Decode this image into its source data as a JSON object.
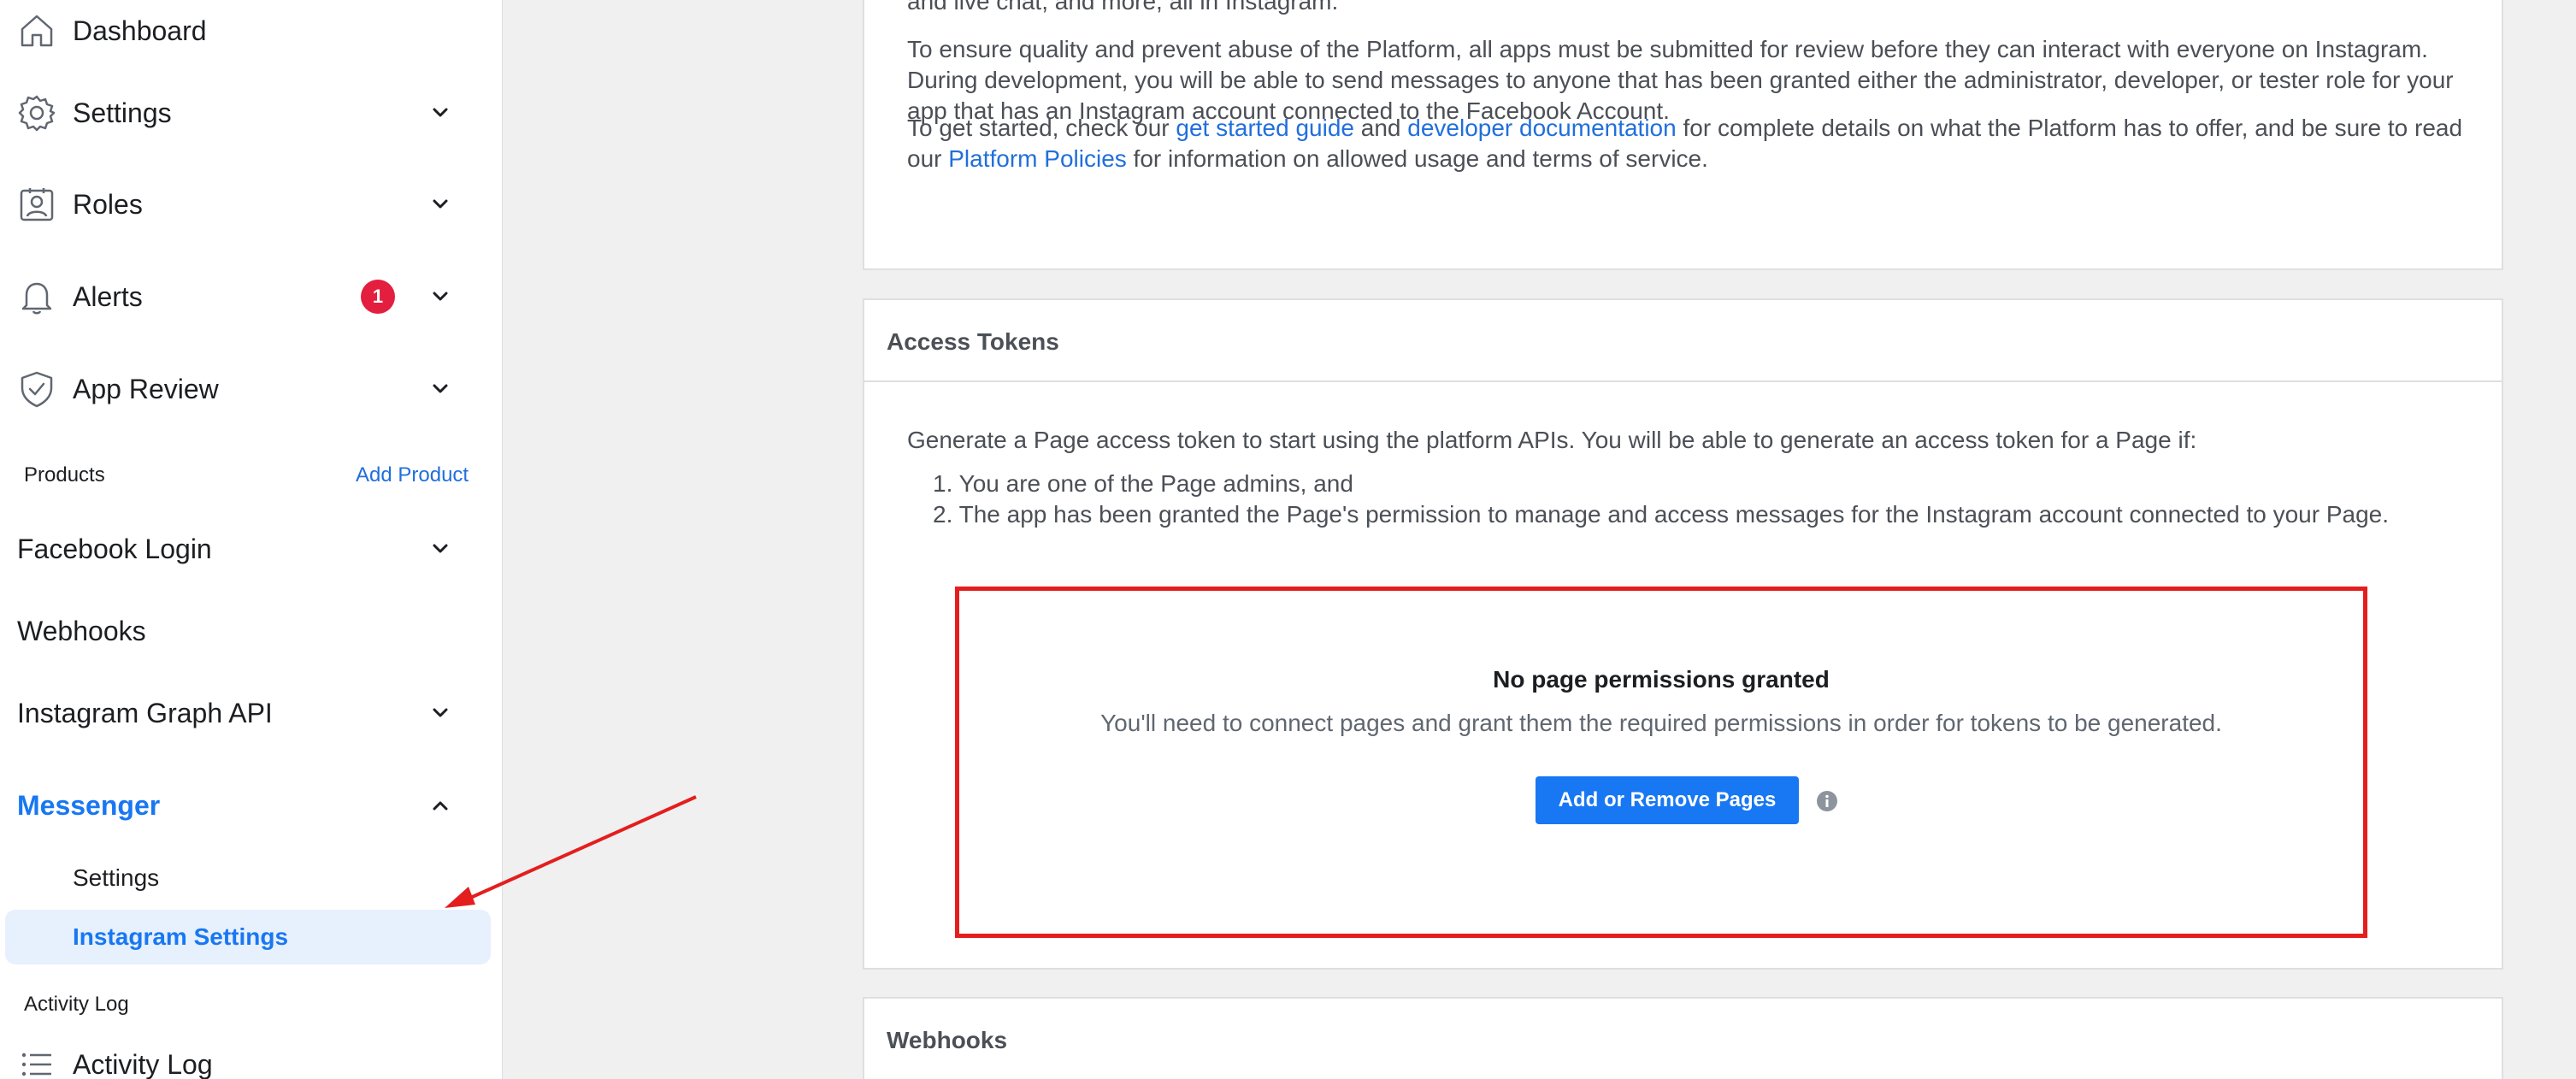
{
  "sidebar": {
    "dashboard": "Dashboard",
    "settings": "Settings",
    "roles": "Roles",
    "alerts": "Alerts",
    "alerts_badge": "1",
    "app_review": "App Review",
    "products_heading": "Products",
    "add_product": "Add Product",
    "facebook_login": "Facebook Login",
    "webhooks": "Webhooks",
    "instagram_graph_api": "Instagram Graph API",
    "messenger": "Messenger",
    "messenger_settings": "Settings",
    "instagram_settings": "Instagram Settings",
    "activity_heading": "Activity Log",
    "activity_log": "Activity Log"
  },
  "intro_card": {
    "cut_line": "and live chat, and more, all in Instagram.",
    "para1": "To ensure quality and prevent abuse of the Platform, all apps must be submitted for review before they can interact with everyone on Instagram. During development, you will be able to send messages to anyone that has been granted either the administrator, developer, or tester role for your app that has an Instagram account connected to the Facebook Account.",
    "para2_a": "To get started, check our ",
    "get_started_guide": "get started guide",
    "para2_b": " and ",
    "developer_documentation": "developer documentation",
    "para2_c": " for complete details on what the Platform has to offer, and be sure to read our ",
    "platform_policies": "Platform Policies",
    "para2_d": " for information on allowed usage and terms of service."
  },
  "access_tokens": {
    "title": "Access Tokens",
    "intro": "Generate a Page access token to start using the platform APIs. You will be able to generate an access token for a Page if:",
    "item1": "1. You are one of the Page admins, and",
    "item2": "2. The app has been granted the Page's permission to manage and access messages for the Instagram account connected to your Page.",
    "empty_title": "No page permissions granted",
    "empty_desc": "You'll need to connect pages and grant them the required permissions in order for tokens to be generated.",
    "button": "Add or Remove Pages"
  },
  "webhooks_card": {
    "title": "Webhooks"
  },
  "icons": [
    "home-icon",
    "gear-icon",
    "roles-icon",
    "bell-icon",
    "shield-check-icon",
    "chevron-down-icon",
    "chevron-up-icon",
    "info-icon",
    "list-icon"
  ],
  "colors": {
    "accent": "#1877f2",
    "badge": "#e41e3f",
    "annotation_red": "#e41e1e",
    "selected_bg": "#e7f0fd"
  }
}
